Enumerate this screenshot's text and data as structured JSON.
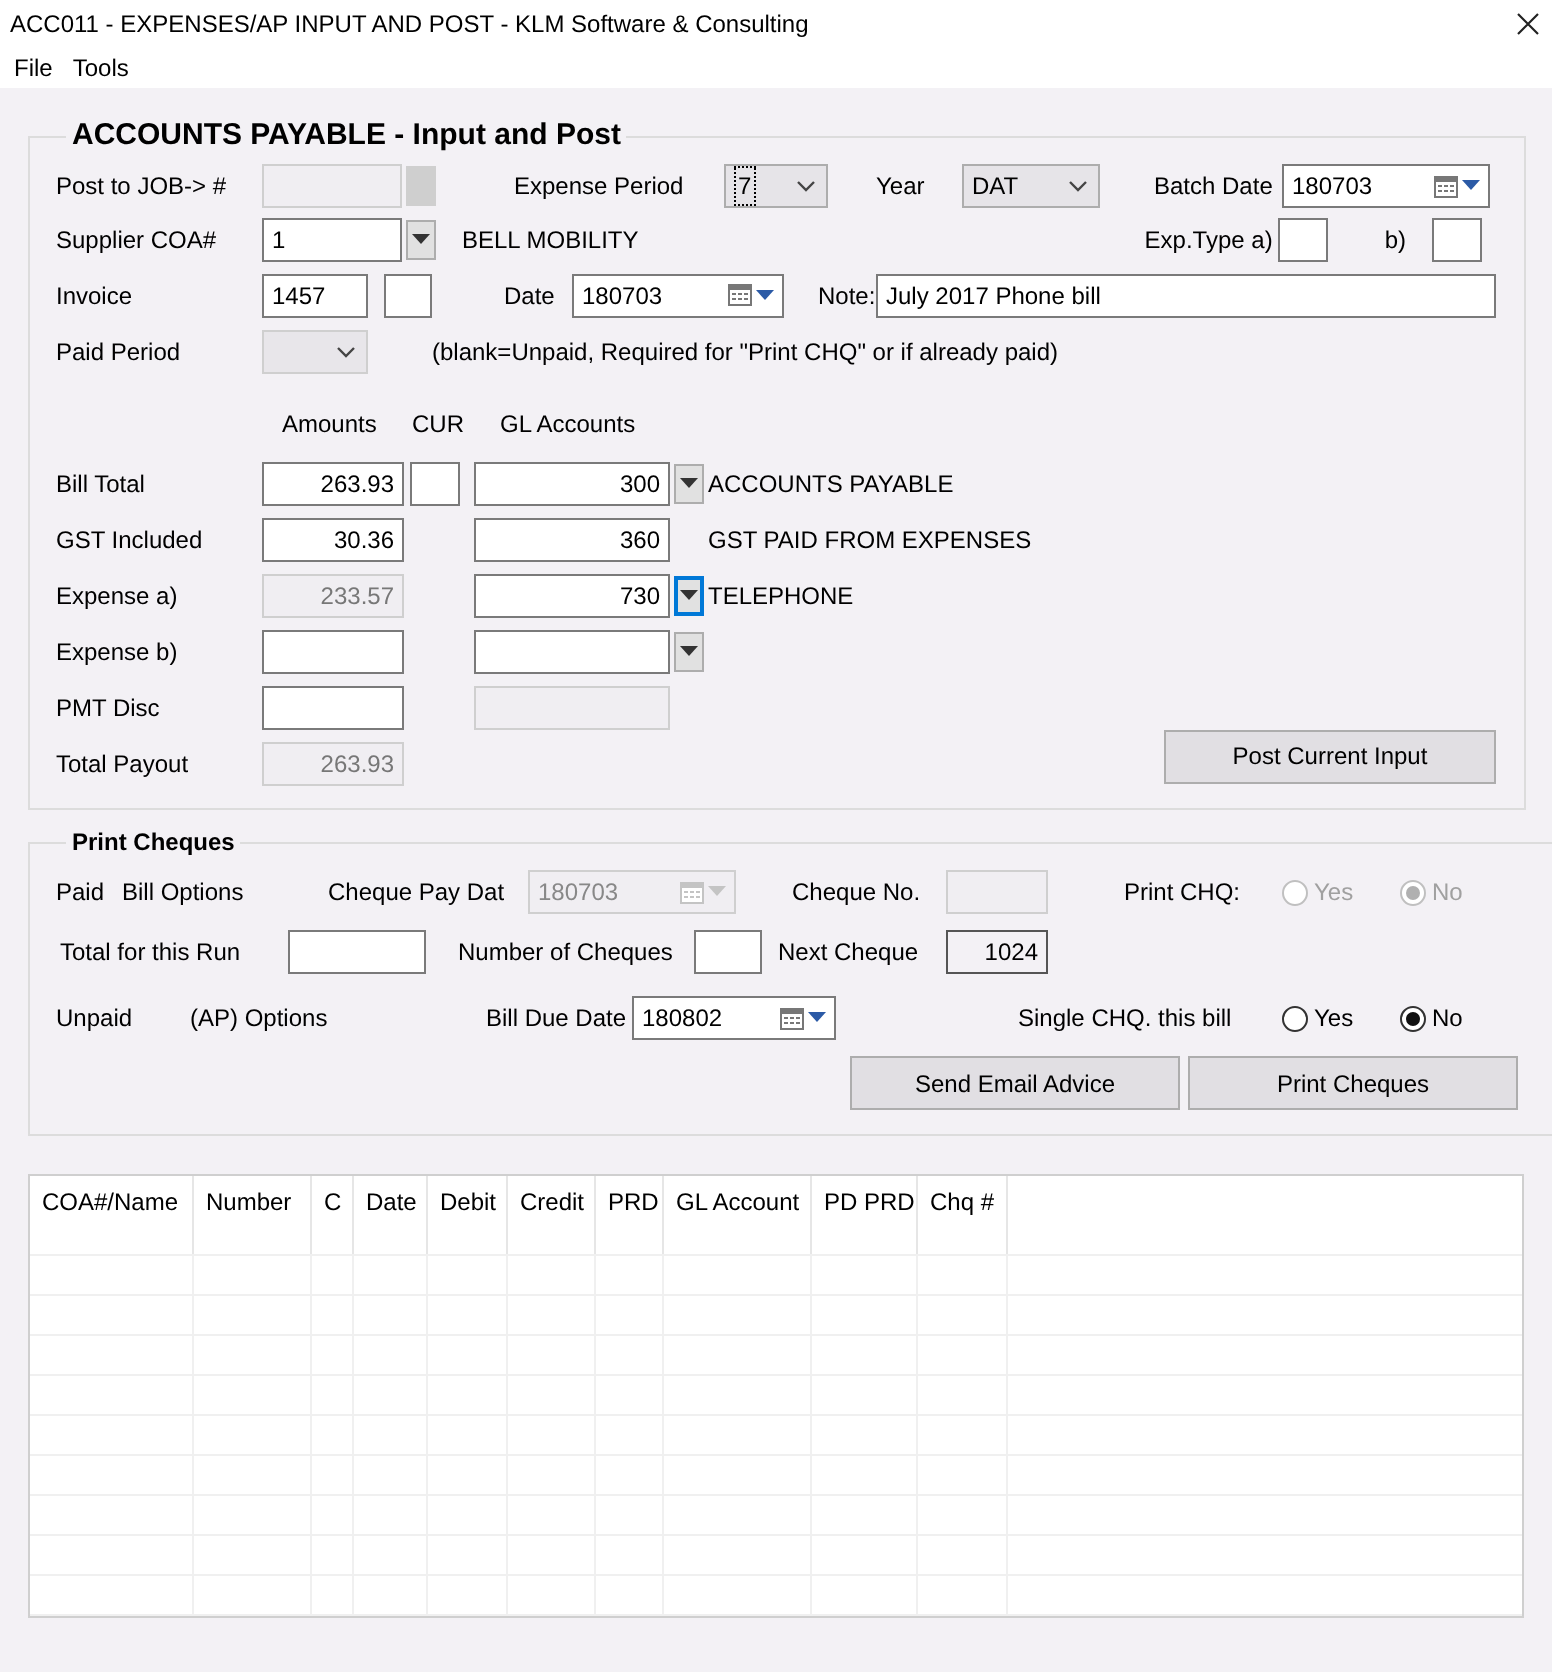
{
  "window": {
    "title": "ACC011 - EXPENSES/AP INPUT AND POST - KLM Software & Consulting"
  },
  "menu": [
    {
      "label": "File"
    },
    {
      "label": "Tools"
    }
  ],
  "input_section": {
    "title": "ACCOUNTS PAYABLE - Input and Post",
    "post_to_job": {
      "label": "Post to JOB-> #",
      "disabled": true
    },
    "expense_period": {
      "label": "Expense Period",
      "value": "7"
    },
    "year": {
      "label": "Year",
      "value": "DAT"
    },
    "batch_date": {
      "label": "Batch Date",
      "value": "180703"
    },
    "supplier": {
      "label": "Supplier COA#",
      "value": "1",
      "name": "BELL MOBILITY"
    },
    "exp_type": {
      "label_a": "Exp.Type a)",
      "label_b": "b)"
    },
    "invoice": {
      "label": "Invoice",
      "value": "1457"
    },
    "date": {
      "label": "Date",
      "value": "180703"
    },
    "note": {
      "label": "Note:",
      "value": "July 2017 Phone bill"
    },
    "paid_period": {
      "label": "Paid Period",
      "disabled": true,
      "hint": "(blank=Unpaid, Required for \"Print CHQ\" or if already paid)"
    },
    "column_headers": [
      "Amounts",
      "CUR",
      "GL Accounts"
    ],
    "lines": [
      {
        "label": "Bill Total",
        "amount": "263.93",
        "amount_disabled": false,
        "cur": true,
        "kind": "combo",
        "account": "300",
        "focused": false,
        "account_name": "ACCOUNTS PAYABLE"
      },
      {
        "label": "GST Included",
        "amount": "30.36",
        "amount_disabled": false,
        "cur": false,
        "kind": "text",
        "account": "360",
        "account_name": "GST PAID FROM EXPENSES"
      },
      {
        "label": "Expense a)",
        "amount": "233.57",
        "amount_disabled": true,
        "cur": false,
        "kind": "combo",
        "account": "730",
        "focused": true,
        "account_name": "TELEPHONE"
      },
      {
        "label": "Expense b)",
        "amount_disabled": false,
        "cur": false,
        "kind": "combo",
        "focused": false
      },
      {
        "label": "PMT Disc",
        "amount_disabled": false,
        "cur": false,
        "kind": "disabled"
      },
      {
        "label": "Total Payout",
        "amount": "263.93",
        "amount_disabled": true,
        "cur": false,
        "kind": "none"
      }
    ],
    "post_button": "Post Current Input"
  },
  "cheques_section": {
    "title": "Print Cheques",
    "paid_label": "Paid",
    "bill_options": "Bill Options",
    "cheque_pay_date": {
      "label": "Cheque Pay Dat",
      "value": "180703",
      "disabled": true
    },
    "cheque_no": {
      "label": "Cheque No.",
      "disabled": true
    },
    "print_chq": {
      "label": "Print CHQ:",
      "disabled": true,
      "options": [
        {
          "label": "Yes",
          "selected": false
        },
        {
          "label": "No",
          "selected": true
        }
      ]
    },
    "total_for_run": {
      "label": "Total for this Run"
    },
    "number_of_cheques": {
      "label": "Number of Cheques"
    },
    "next_cheque": {
      "label": "Next Cheque",
      "value": "1024"
    },
    "unpaid_label": "Unpaid",
    "ap_options": "(AP) Options",
    "bill_due_date": {
      "label": "Bill Due Date",
      "value": "180802"
    },
    "single_chq": {
      "label": "Single CHQ. this bill",
      "options": [
        {
          "label": "Yes",
          "selected": false
        },
        {
          "label": "No",
          "selected": true
        }
      ]
    },
    "buttons": [
      "Send Email Advice",
      "Print Cheques"
    ]
  },
  "table": {
    "columns": [
      "COA#/Name",
      "Number",
      "C",
      "Date",
      "Debit",
      "Credit",
      "PRD",
      "GL Account",
      "PD PRD",
      "Chq #"
    ]
  }
}
